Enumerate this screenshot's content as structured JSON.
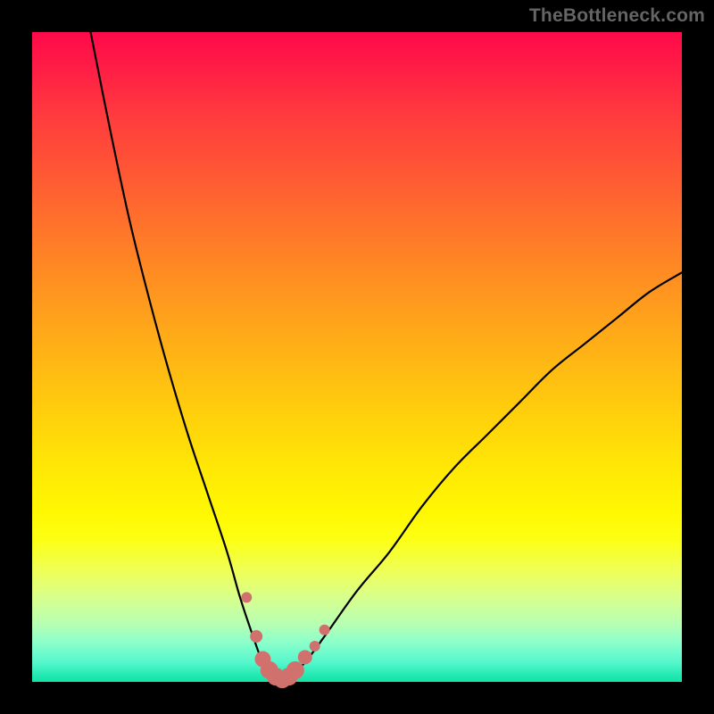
{
  "branding": {
    "text": "TheBottleneck.com"
  },
  "chart_data": {
    "type": "line",
    "title": "",
    "xlabel": "",
    "ylabel": "",
    "x_range": [
      0,
      100
    ],
    "y_range": [
      0,
      100
    ],
    "series": [
      {
        "name": "bottleneck-curve",
        "x": [
          9,
          12,
          15,
          18,
          21,
          24,
          27,
          30,
          32,
          34,
          35.5,
          37,
          38,
          39,
          40,
          42,
          45,
          50,
          55,
          60,
          65,
          70,
          75,
          80,
          85,
          90,
          95,
          100
        ],
        "y": [
          100,
          85,
          71,
          59,
          48,
          38,
          29,
          20,
          13,
          7,
          3,
          1,
          0,
          0,
          1,
          3,
          7,
          14,
          20,
          27,
          33,
          38,
          43,
          48,
          52,
          56,
          60,
          63
        ]
      }
    ],
    "markers": {
      "name": "highlight-points",
      "color": "#d1716d",
      "x": [
        33.0,
        34.5,
        35.5,
        36.5,
        37.5,
        38.5,
        39.5,
        40.5,
        42.0,
        43.5,
        45.0
      ],
      "y": [
        13,
        7,
        3.5,
        1.8,
        0.8,
        0.4,
        0.8,
        1.8,
        3.8,
        5.5,
        8
      ],
      "sizes": [
        6,
        7,
        9,
        10,
        10,
        10,
        10,
        10,
        8,
        6,
        6
      ]
    },
    "background_gradient": {
      "top": "#ff0a4a",
      "mid": "#ffea05",
      "bottom": "#14e3a4"
    }
  }
}
